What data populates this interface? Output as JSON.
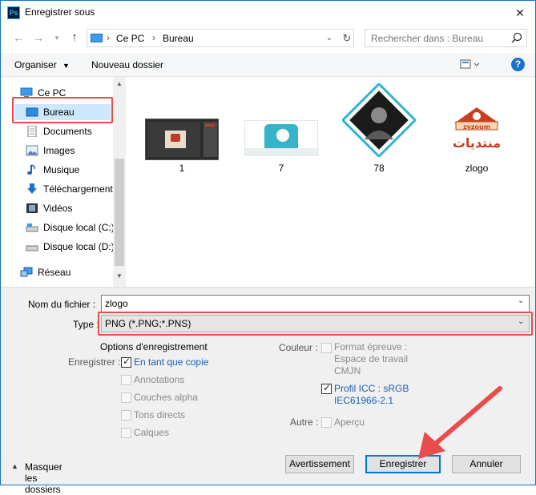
{
  "window": {
    "app_icon": "Ps",
    "title": "Enregistrer sous",
    "close_icon": "close-icon"
  },
  "address": {
    "crumbs": [
      "Ce PC",
      "Bureau"
    ],
    "search_placeholder": "Rechercher dans : Bureau"
  },
  "toolbar": {
    "organize_label": "Organiser",
    "new_folder_label": "Nouveau dossier"
  },
  "sidebar": {
    "items": [
      {
        "label": "Ce PC",
        "icon": "computer-icon"
      },
      {
        "label": "Bureau",
        "icon": "desktop-icon"
      },
      {
        "label": "Documents",
        "icon": "documents-icon"
      },
      {
        "label": "Images",
        "icon": "images-icon"
      },
      {
        "label": "Musique",
        "icon": "music-icon"
      },
      {
        "label": "Téléchargement",
        "icon": "download-icon"
      },
      {
        "label": "Vidéos",
        "icon": "videos-icon"
      },
      {
        "label": "Disque local (C:)",
        "icon": "drive-icon"
      },
      {
        "label": "Disque local (D:)",
        "icon": "drive-icon"
      },
      {
        "label": "Réseau",
        "icon": "network-icon"
      }
    ]
  },
  "files": [
    {
      "name": "1"
    },
    {
      "name": "7"
    },
    {
      "name": "78"
    },
    {
      "name": "zlogo",
      "logo_text": "zyzoum",
      "logo_subtext": "منتديات"
    }
  ],
  "form": {
    "filename_label": "Nom du fichier :",
    "filename_value": "zlogo",
    "type_label": "Type :",
    "type_value": "PNG (*.PNG;*.PNS)",
    "options_title": "Options d'enregistrement",
    "save_label": "Enregistrer :",
    "save_options": [
      {
        "label": "En tant que copie",
        "checked": true,
        "enabled": true
      },
      {
        "label": "Annotations",
        "checked": false,
        "enabled": false
      },
      {
        "label": "Couches alpha",
        "checked": false,
        "enabled": false
      },
      {
        "label": "Tons directs",
        "checked": false,
        "enabled": false
      },
      {
        "label": "Calques",
        "checked": false,
        "enabled": false
      }
    ],
    "color_label": "Couleur :",
    "proof_format": {
      "line1": "Format épreuve :",
      "line2": "Espace de travail",
      "line3": "CMJN",
      "checked": false
    },
    "icc_profile": {
      "line1": "Profil ICC : sRGB",
      "line2": "IEC61966-2.1",
      "checked": true
    },
    "other_label": "Autre :",
    "preview_label": "Aperçu"
  },
  "buttons": {
    "hide_folders": "Masquer les dossiers",
    "warning": "Avertissement",
    "save": "Enregistrer",
    "cancel": "Annuler"
  },
  "colors": {
    "accent": "#0078d7",
    "highlight": "#e84c4c",
    "selection": "#cce8ff"
  }
}
